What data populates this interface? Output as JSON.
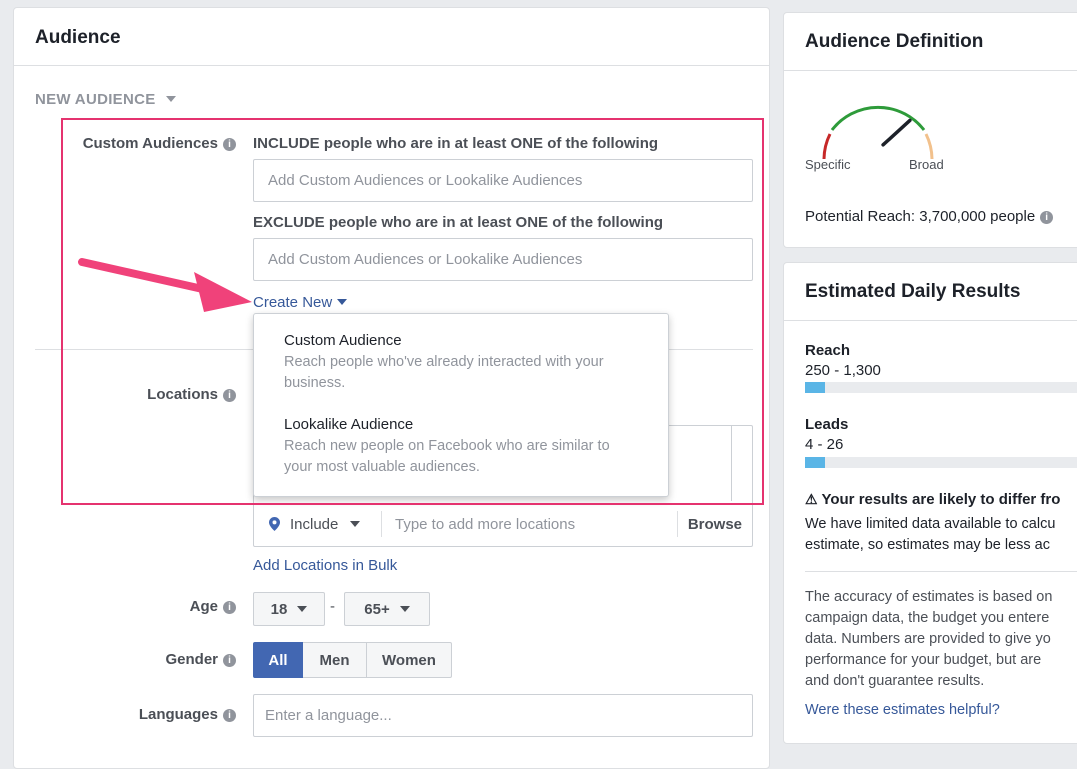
{
  "audience": {
    "title": "Audience",
    "new_audience_label": "NEW AUDIENCE",
    "custom_audiences_label": "Custom Audiences",
    "include_text": "INCLUDE people who are in at least ONE of the following",
    "include_placeholder": "Add Custom Audiences or Lookalike Audiences",
    "exclude_text": "EXCLUDE people who are in at least ONE of the following",
    "exclude_placeholder": "Add Custom Audiences or Lookalike Audiences",
    "create_new_label": "Create New",
    "dropdown": [
      {
        "title": "Custom Audience",
        "description": "Reach people who've already interacted with your business."
      },
      {
        "title": "Lookalike Audience",
        "description": "Reach new people on Facebook who are similar to your most valuable audiences."
      }
    ],
    "locations_label": "Locations",
    "include_select": "Include",
    "location_placeholder": "Type to add more locations",
    "browse_label": "Browse",
    "bulk_link": "Add Locations in Bulk",
    "age_label": "Age",
    "age_min": "18",
    "age_separator": "-",
    "age_max": "65+",
    "gender_label": "Gender",
    "gender_options": [
      "All",
      "Men",
      "Women"
    ],
    "gender_selected": "All",
    "languages_label": "Languages",
    "language_placeholder": "Enter a language..."
  },
  "definition": {
    "title": "Audience Definition",
    "gauge_left": "Specific",
    "gauge_right": "Broad",
    "gauge_level": 0.72,
    "potential_reach": "Potential Reach: 3,700,000 people"
  },
  "results": {
    "title": "Estimated Daily Results",
    "reach_label": "Reach",
    "reach_value": "250 - 1,300",
    "reach_fill": 0.07,
    "leads_label": "Leads",
    "leads_value": "4 - 26",
    "leads_fill": 0.07,
    "warning_title": "Your results are likely to differ fro",
    "warning_line1": "We have limited data available to calcu",
    "warning_line2": "estimate, so estimates may be less ac",
    "accuracy_lines": [
      "The accuracy of estimates is based on",
      "campaign data, the budget you entere",
      "data. Numbers are provided to give yo",
      "performance for your budget, but are",
      "and don't guarantee results."
    ],
    "helpful_link": "Were these estimates helpful?"
  },
  "colors": {
    "highlight": "#e5336f",
    "arrow": "#f0427a",
    "link": "#365899",
    "selected_button": "#4267b2",
    "bar_fill": "#5ab5e6"
  }
}
